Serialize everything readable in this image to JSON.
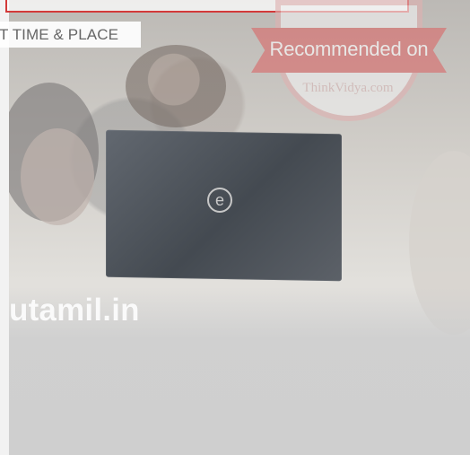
{
  "hero": {
    "tagline": "T TIME & PLACE",
    "brand": "utamil.in"
  },
  "badge": {
    "label": "Recommended on",
    "site": "ThinkVidya.com"
  },
  "colors": {
    "page_bg": "#f2f2f2",
    "overlay_bg": "#cfcfcf",
    "accent_red": "#d33a3a",
    "badge_red": "#d96a6a",
    "brand_text": "#fafafa"
  },
  "icons": {
    "laptop_logo": "dell-logo-icon"
  }
}
